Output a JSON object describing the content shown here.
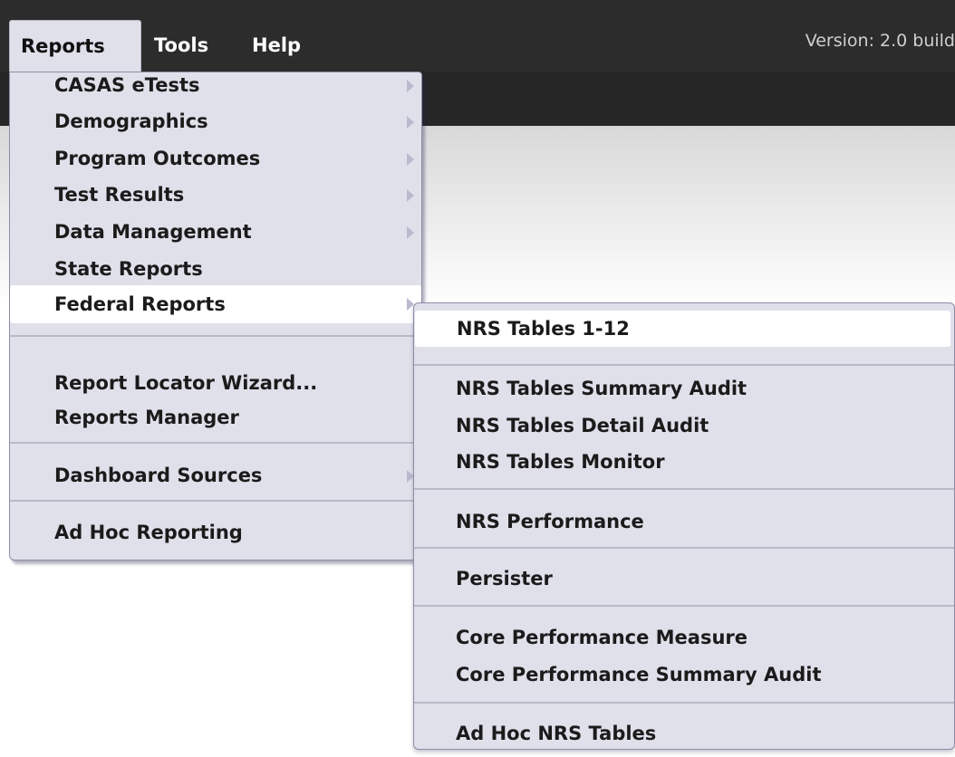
{
  "menubar": {
    "reports": "Reports",
    "tools": "Tools",
    "help": "Help",
    "version": "Version: 2.0 build"
  },
  "reports_menu": {
    "items": [
      "CASAS eTests",
      "Demographics",
      "Program Outcomes",
      "Test Results",
      "Data Management",
      "State Reports",
      "Federal Reports",
      "Report Locator Wizard...",
      "Reports Manager",
      "Dashboard Sources",
      "Ad Hoc Reporting"
    ]
  },
  "federal_submenu": {
    "items": [
      "NRS Tables 1-12",
      "NRS Tables Summary Audit",
      "NRS Tables Detail Audit",
      "NRS Tables Monitor",
      "NRS Performance",
      "Persister",
      "Core Performance Measure",
      "Core Performance Summary Audit",
      "Ad Hoc NRS Tables"
    ]
  }
}
